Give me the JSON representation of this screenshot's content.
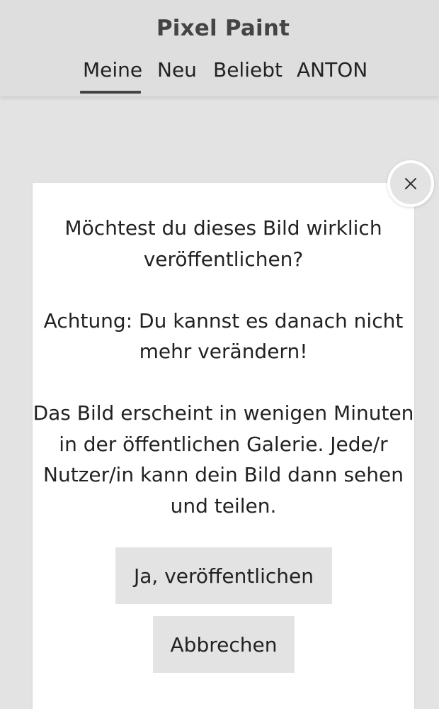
{
  "header": {
    "title": "Pixel Paint",
    "tabs": [
      {
        "label": "Meine",
        "active": true
      },
      {
        "label": "Neu",
        "active": false
      },
      {
        "label": "Beliebt",
        "active": false
      },
      {
        "label": "ANTON",
        "active": false
      }
    ]
  },
  "dialog": {
    "paragraphs": [
      "Möchtest du dieses Bild wirklich veröffentlichen?",
      "Achtung: Du kannst es danach nicht mehr verändern!",
      "Das Bild erscheint in wenigen Minuten in der öffentlichen Galerie. Jede/r Nutzer/in kann dein Bild dann sehen und teilen."
    ],
    "confirm_label": "Ja, veröffentlichen",
    "cancel_label": "Abbrechen",
    "close_icon": "close-icon"
  },
  "colors": {
    "background": "#e3e3e3",
    "header": "#dedede",
    "dialog": "#ffffff",
    "text": "#222222",
    "title": "#444444",
    "button": "#e3e3e3"
  }
}
